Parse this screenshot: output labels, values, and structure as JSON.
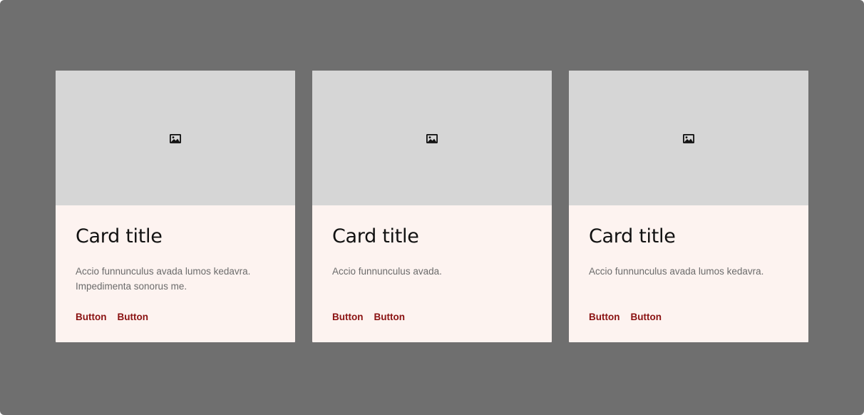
{
  "cards": [
    {
      "image_icon": "image-icon",
      "title": "Card title",
      "text": "Accio funnunculus avada lumos kedavra. Impedimenta sonorus me.",
      "buttons": [
        "Button",
        "Button"
      ]
    },
    {
      "image_icon": "image-icon",
      "title": "Card title",
      "text": "Accio funnunculus avada.",
      "buttons": [
        "Button",
        "Button"
      ]
    },
    {
      "image_icon": "image-icon",
      "title": "Card title",
      "text": "Accio funnunculus avada lumos kedavra.",
      "buttons": [
        "Button",
        "Button"
      ]
    }
  ],
  "colors": {
    "background": "#6f6f6f",
    "card_surface": "#fdf3f0",
    "media_placeholder": "#d6d6d6",
    "button_text": "#8a1111"
  }
}
